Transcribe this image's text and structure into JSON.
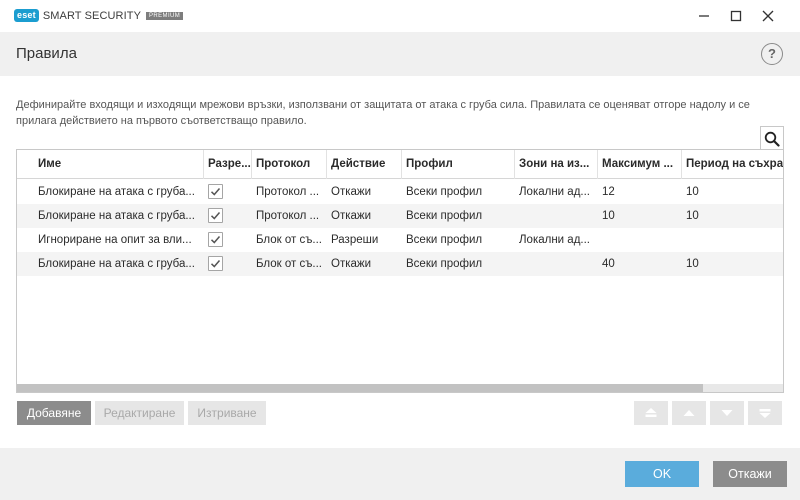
{
  "titlebar": {
    "logo_brand": "eset",
    "logo_product": "SMART SECURITY",
    "logo_edition": "PREMIUM",
    "brand_color": "#1b9dd0"
  },
  "header": {
    "title": "Правила",
    "help_label": "?"
  },
  "description": "Дефинирайте входящи и изходящи мрежови връзки, използвани от защитата от атака с груба сила. Правилата се оценяват отгоре надолу и се прилага действието на първото съответстващо правило.",
  "table": {
    "columns": [
      "Име",
      "Разре...",
      "Протокол",
      "Действие",
      "Профил",
      "Зони на из...",
      "Максимум ...",
      "Период на съхра"
    ],
    "rows": [
      {
        "name": "Блокиране на атака с груба...",
        "enabled": true,
        "protocol": "Протокол ...",
        "action": "Откажи",
        "profile": "Всеки профил",
        "zones": "Локални ад...",
        "max": "12",
        "period": "10"
      },
      {
        "name": "Блокиране на атака с груба...",
        "enabled": true,
        "protocol": "Протокол ...",
        "action": "Откажи",
        "profile": "Всеки профил",
        "zones": "",
        "max": "10",
        "period": "10"
      },
      {
        "name": "Игнориране на опит за вли...",
        "enabled": true,
        "protocol": "Блок от съ...",
        "action": "Разреши",
        "profile": "Всеки профил",
        "zones": "Локални ад...",
        "max": "",
        "period": ""
      },
      {
        "name": "Блокиране на атака с груба...",
        "enabled": true,
        "protocol": "Блок от съ...",
        "action": "Откажи",
        "profile": "Всеки профил",
        "zones": "",
        "max": "40",
        "period": "10"
      }
    ]
  },
  "buttons": {
    "add": "Добавяне",
    "edit": "Редактиране",
    "delete": "Изтриване",
    "ok": "OK",
    "cancel": "Откажи"
  }
}
